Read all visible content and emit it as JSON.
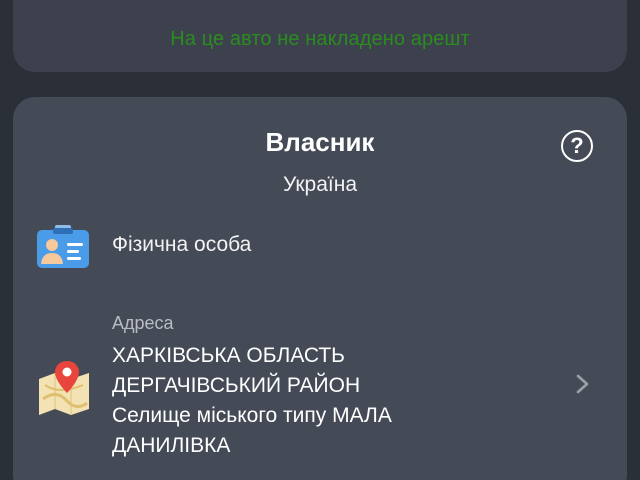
{
  "arrest_status": {
    "text": "На це авто не накладено арешт",
    "color": "#2a8c1e"
  },
  "owner": {
    "title": "Власник",
    "help_icon": "question-circle-icon",
    "country": "Україна",
    "person_type": {
      "icon": "id-card-icon",
      "label": "Фізична особа"
    },
    "address": {
      "icon": "map-pin-icon",
      "caption": "Адреса",
      "lines": [
        "ХАРКІВСЬКА ОБЛАСТЬ",
        "ДЕРГАЧІВСЬКИЙ РАЙОН",
        "Селище міського типу МАЛА",
        "ДАНИЛІВКА"
      ],
      "chevron_icon": "chevron-right-icon"
    }
  },
  "colors": {
    "background": "#2b2f38",
    "card": "#454a57",
    "id_card_blue": "#4a9be8",
    "map_pin_red": "#e8453c"
  }
}
